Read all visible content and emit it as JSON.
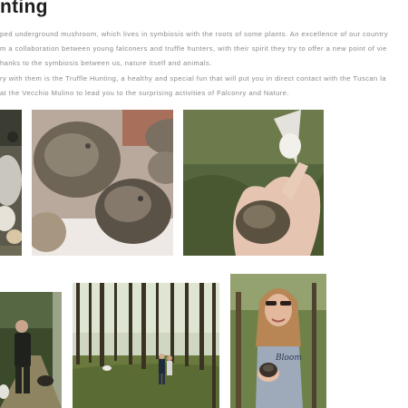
{
  "page": {
    "title": "nting",
    "paragraph_lines": [
      "ped underground mushroom, which lives in symbiosis with the roots of some plants. An excellence of our country",
      "m a collaboration between young falconers and truffle hunters, with their spirit they try to offer a new point of vie",
      "hanks to the symbiosis between us, nature itself and animals.",
      "ry with them is the Truffle Hunting, a healthy and special fun that will put you in direct contact with the Tuscan la",
      "at the Vecchio Mulino to lead you to the surprising activities of Falconry and Nature."
    ]
  },
  "gallery": {
    "row1": [
      {
        "name": "photo-dog-truffle-partial"
      },
      {
        "name": "photo-truffles-closeup"
      },
      {
        "name": "photo-truffle-in-hand"
      }
    ],
    "row2": [
      {
        "name": "photo-hunter-with-dog"
      },
      {
        "name": "photo-pine-forest-walk"
      },
      {
        "name": "photo-woman-holding-truffle",
        "shirt_text": "Bloom"
      }
    ]
  },
  "colors": {
    "title": "#1d1d1d",
    "body_text": "#8a8a8a",
    "background": "#ffffff"
  }
}
